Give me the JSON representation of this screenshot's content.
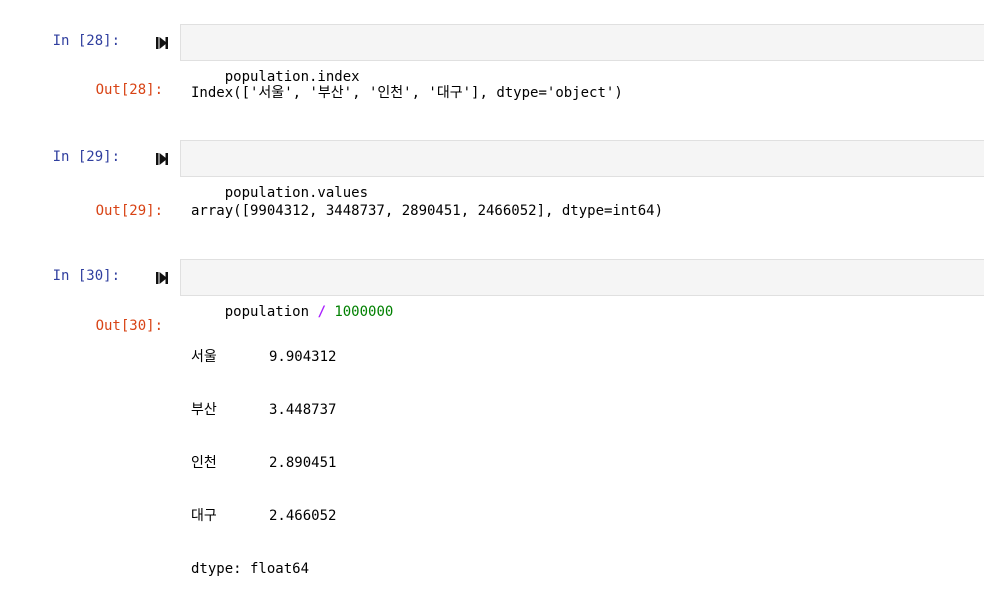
{
  "cells": [
    {
      "in_prompt": "In [28]:",
      "code": "population.index",
      "out_prompt": "Out[28]:",
      "output": "Index(['서울', '부산', '인천', '대구'], dtype='object')"
    },
    {
      "in_prompt": "In [29]:",
      "code": "population.values",
      "out_prompt": "Out[29]:",
      "output": "array([9904312, 3448737, 2890451, 2466052], dtype=int64)"
    },
    {
      "in_prompt": "In [30]:",
      "code_var": "population",
      "code_op": "/",
      "code_num": "1000000",
      "out_prompt": "Out[30]:",
      "series": [
        {
          "index": "서울",
          "value": "9.904312"
        },
        {
          "index": "부산",
          "value": "3.448737"
        },
        {
          "index": "인천",
          "value": "2.890451"
        },
        {
          "index": "대구",
          "value": "2.466052"
        }
      ],
      "dtype": "dtype: float64"
    }
  ]
}
